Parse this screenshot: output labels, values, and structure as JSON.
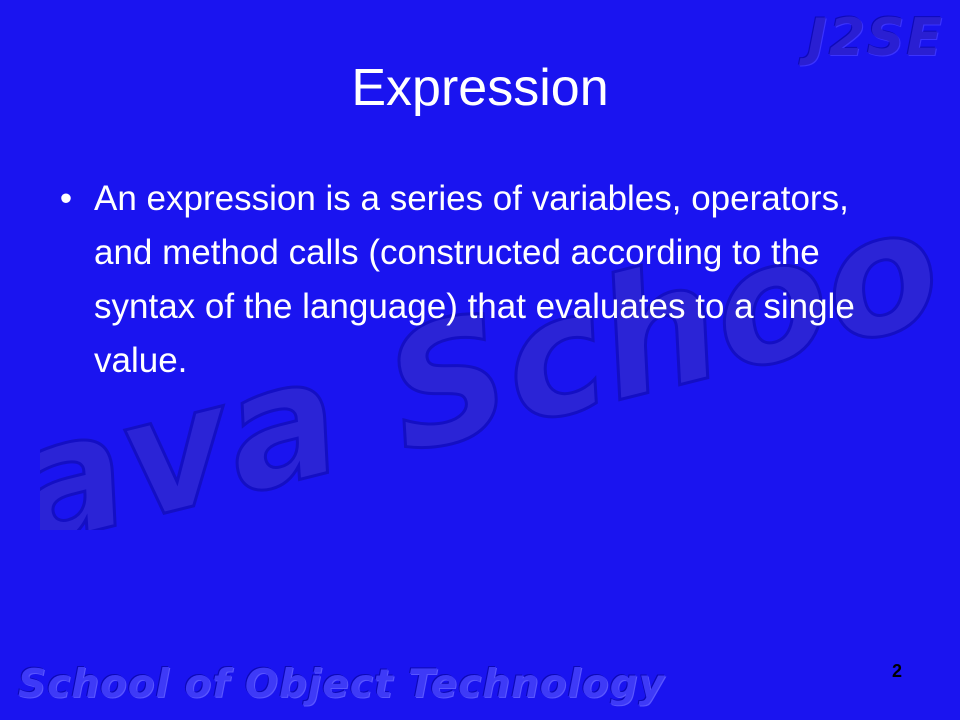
{
  "slide": {
    "brand_tag": "J2SE",
    "title": "Expression",
    "bullets": [
      {
        "marker": "•",
        "text": "An expression is a series of variables, operators, and method calls (constructed according to the syntax of the language) that evaluates to a single value."
      }
    ],
    "watermark": "Java School",
    "footer": "School of Object Technology",
    "page_number": "2"
  },
  "colors": {
    "background": "#1a14f0",
    "text": "#ffffff",
    "watermark": "#2b24d6",
    "footer": "#3e3af7",
    "page_number": "#000000"
  }
}
